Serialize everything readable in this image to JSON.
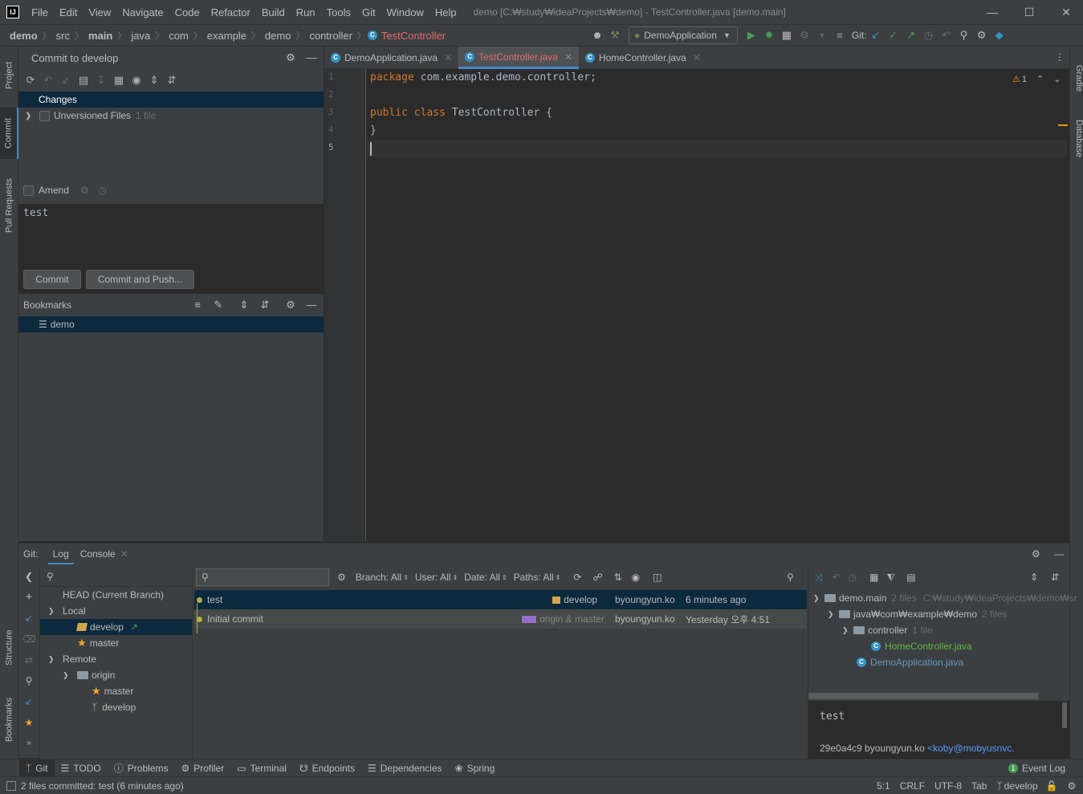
{
  "window": {
    "menu": [
      "File",
      "Edit",
      "View",
      "Navigate",
      "Code",
      "Refactor",
      "Build",
      "Run",
      "Tools",
      "Git",
      "Window",
      "Help"
    ],
    "title": "demo [C:₩study₩ideaProjects₩demo] - TestController.java [demo.main]"
  },
  "nav": {
    "breadcrumbs": [
      "demo",
      "src",
      "main",
      "java",
      "com",
      "example",
      "demo",
      "controller"
    ],
    "current": "TestController",
    "run_config": "DemoApplication",
    "git_label": "Git:"
  },
  "sidebar_left": {
    "tabs": [
      "Project",
      "Commit",
      "Pull Requests",
      "Structure",
      "Bookmarks"
    ]
  },
  "sidebar_right": {
    "tabs": [
      "Gradle",
      "Database"
    ]
  },
  "commit": {
    "title": "Commit to develop",
    "changes_label": "Changes",
    "unversioned_label": "Unversioned Files",
    "unversioned_count": "1 file",
    "amend_label": "Amend",
    "message": "test",
    "commit_button": "Commit",
    "commit_push_button": "Commit and Push..."
  },
  "bookmarks": {
    "title": "Bookmarks",
    "items": [
      "demo"
    ]
  },
  "editor": {
    "tabs": [
      {
        "label": "DemoApplication.java"
      },
      {
        "label": "TestController.java"
      },
      {
        "label": "HomeController.java"
      }
    ],
    "warnings": "1",
    "lines": [
      "1",
      "2",
      "3",
      "4",
      "5"
    ],
    "code": {
      "l1_kw": "package",
      "l1_rest": " com.example.demo.controller;",
      "l3_kw": "public class",
      "l3_rest": " TestController {",
      "l4": "}"
    }
  },
  "git": {
    "label": "Git:",
    "tabs": [
      "Log",
      "Console"
    ],
    "branches": {
      "head": "HEAD (Current Branch)",
      "local": "Local",
      "local_items": [
        "develop",
        "master"
      ],
      "remote": "Remote",
      "origin": "origin",
      "origin_items": [
        "master",
        "develop"
      ]
    },
    "filters": {
      "branch": "Branch: All",
      "user": "User: All",
      "date": "Date: All",
      "paths": "Paths: All"
    },
    "commits": [
      {
        "message": "test",
        "refs": "develop",
        "author": "byoungyun.ko",
        "date": "6 minutes ago"
      },
      {
        "message": "Initial commit",
        "refs": "origin & master",
        "author": "byoungyun.ko",
        "date": "Yesterday 오후 4:51"
      }
    ],
    "details": {
      "root": "demo.main",
      "root_count": "2 files",
      "root_path": "C:₩study₩ideaProjects₩demo₩sr",
      "pkg": "java₩com₩example₩demo",
      "pkg_count": "2 files",
      "controller": "controller",
      "controller_count": "1 file",
      "file1": "HomeController.java",
      "file2": "DemoApplication.java",
      "commit_msg": "test",
      "hash_author": "29e0a4c9 byoungyun.ko",
      "email": "<koby@mobyusnvc."
    }
  },
  "bottom_tabs": [
    "Git",
    "TODO",
    "Problems",
    "Profiler",
    "Terminal",
    "Endpoints",
    "Dependencies",
    "Spring"
  ],
  "event_log": {
    "count": "1",
    "label": "Event Log"
  },
  "status": {
    "message": "2 files committed: test (6 minutes ago)",
    "position": "5:1",
    "line_sep": "CRLF",
    "encoding": "UTF-8",
    "indent": "Tab",
    "branch": "develop"
  },
  "colors": {
    "accent": "#4a88c7",
    "selection": "#0d293e",
    "keyword": "#cc7832",
    "error_tab": "#e06c6c"
  }
}
